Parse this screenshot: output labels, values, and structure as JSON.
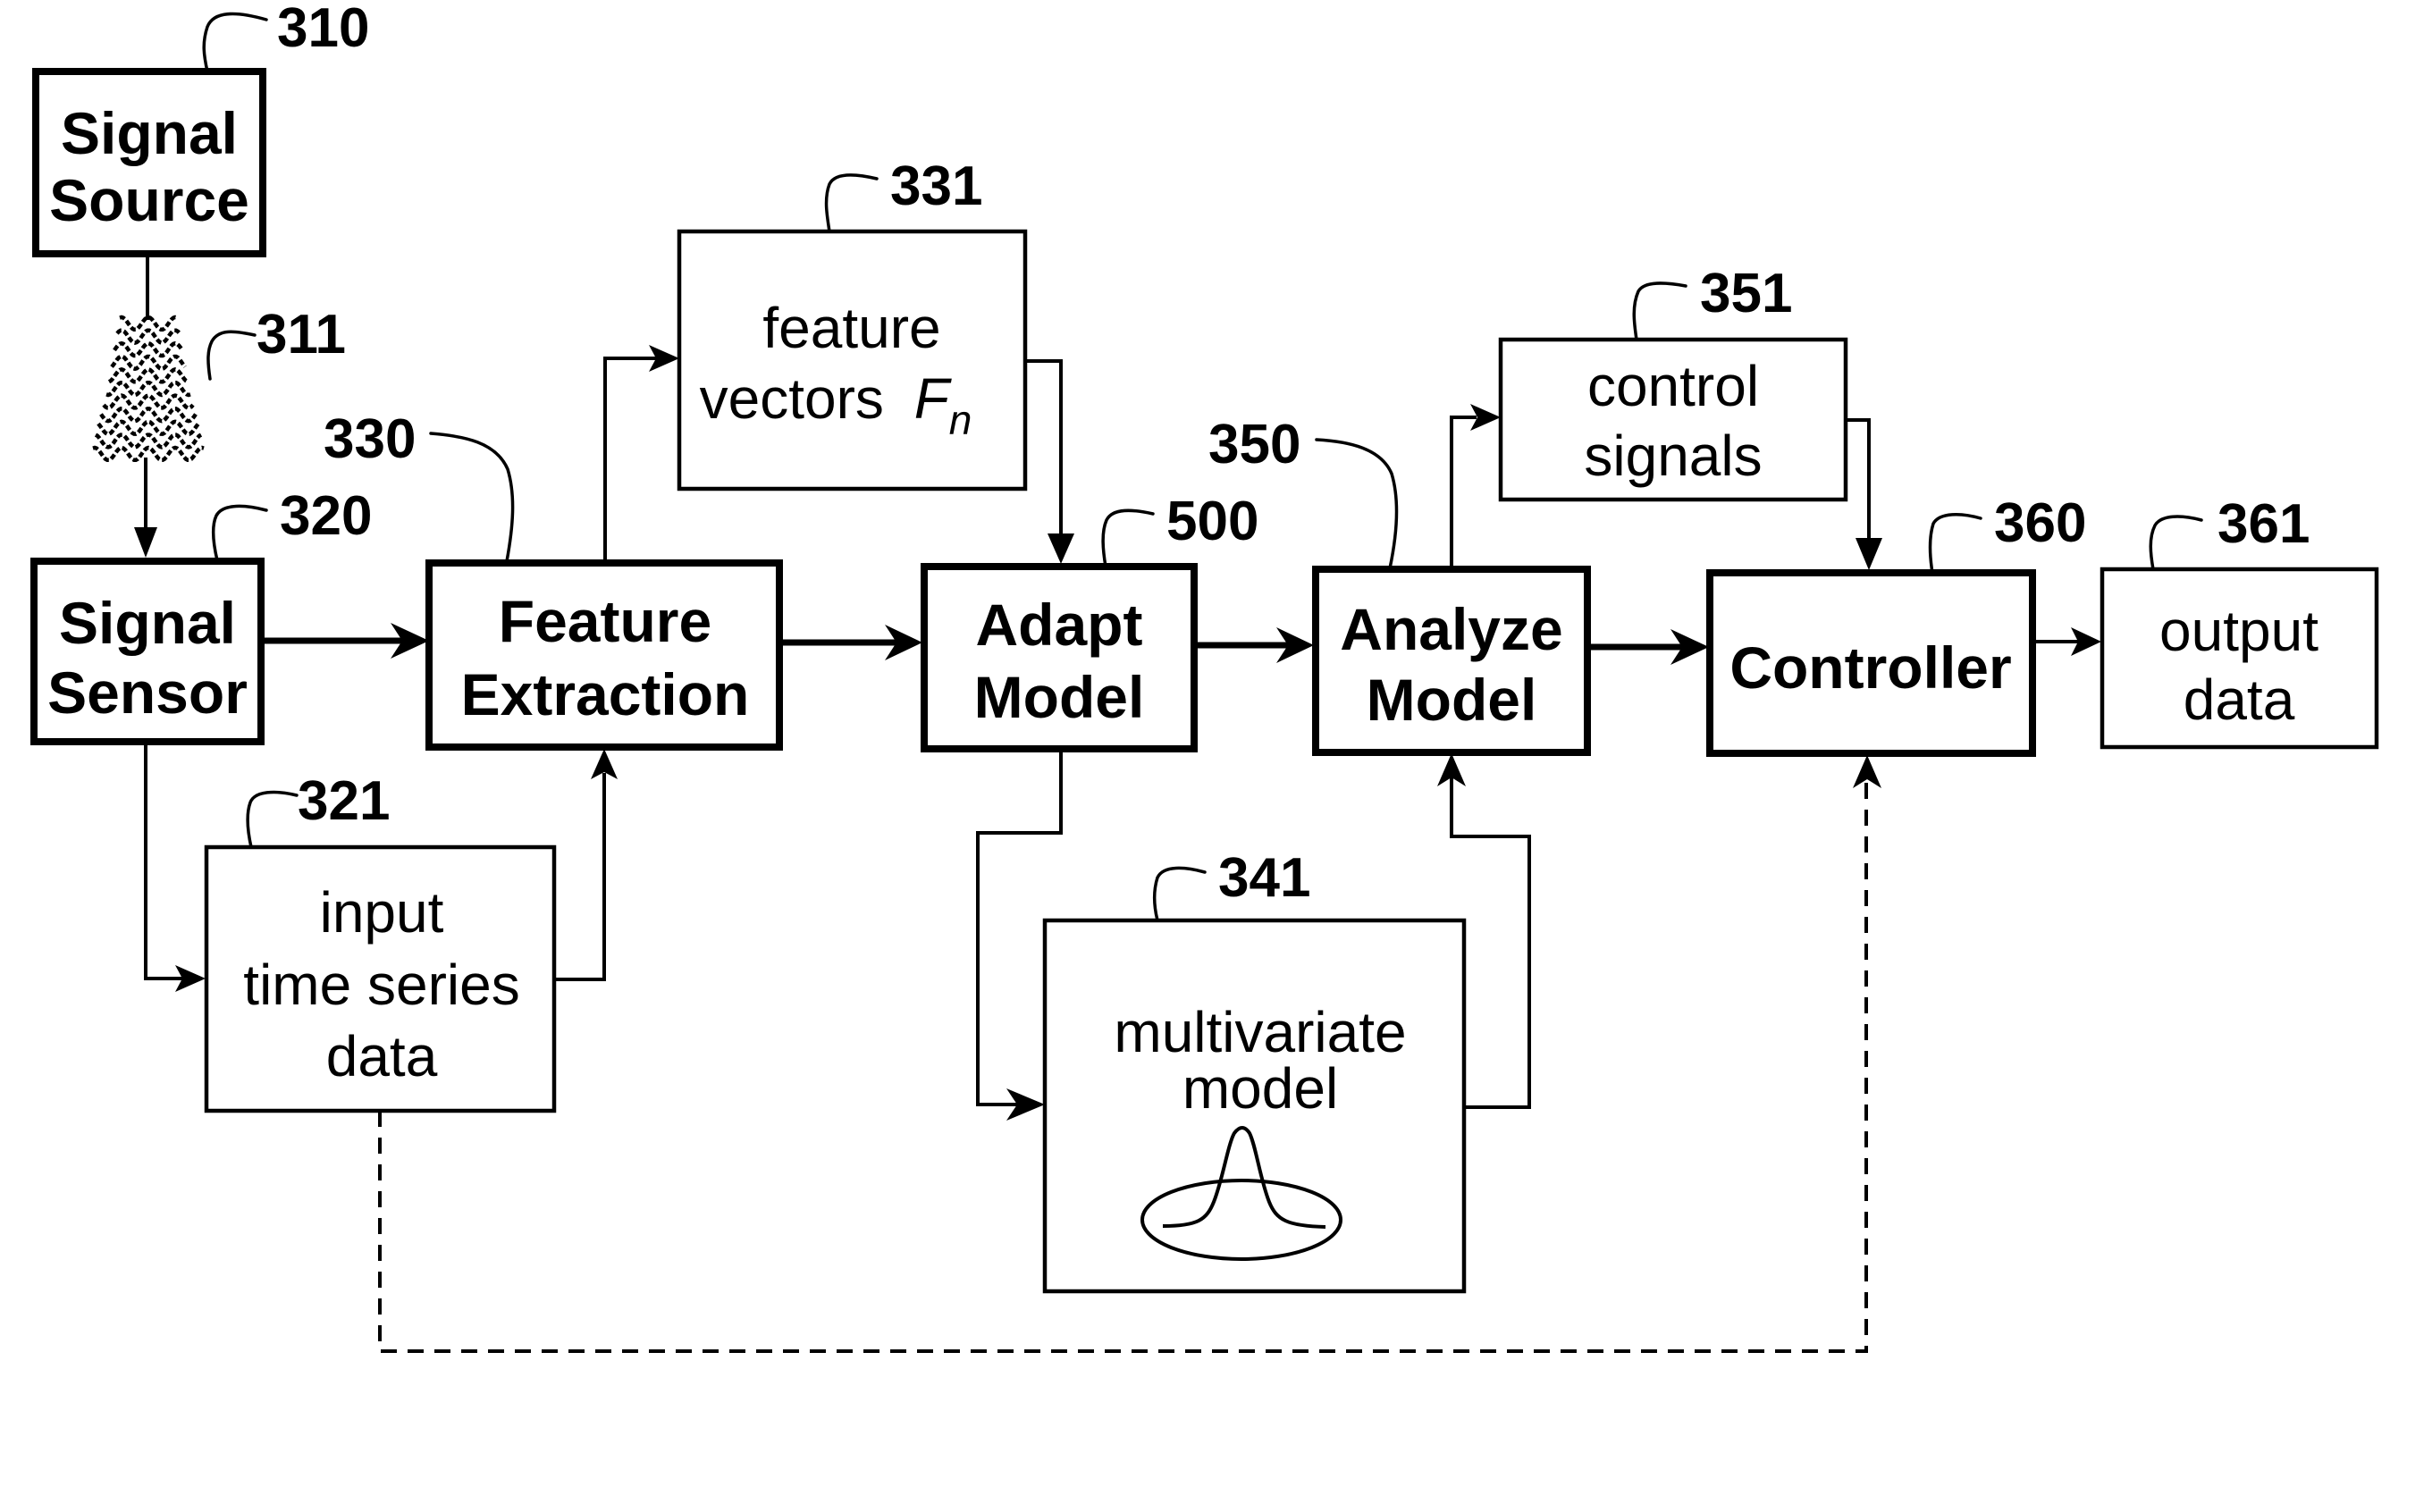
{
  "figure": {
    "type": "block-diagram",
    "description": "Signal processing flow from signal source through feature extraction and model adaptation to a controller"
  },
  "blocks": {
    "signal_source": {
      "ref": "310",
      "lines": [
        "Signal",
        "Source"
      ],
      "style": "bold"
    },
    "signal_sensor": {
      "ref": "320",
      "lines": [
        "Signal",
        "Sensor"
      ],
      "style": "bold"
    },
    "input_data": {
      "ref": "321",
      "lines": [
        "input",
        "time series",
        "data"
      ],
      "style": "regular"
    },
    "feature_extract": {
      "ref": "330",
      "lines": [
        "Feature",
        "Extraction"
      ],
      "style": "bold"
    },
    "feature_vectors": {
      "ref": "331",
      "lines": [
        "feature",
        "vectors"
      ],
      "symbol": "F",
      "subscript": "n",
      "style": "regular"
    },
    "adapt_model": {
      "ref": "500",
      "lines": [
        "Adapt",
        "Model"
      ],
      "style": "bold"
    },
    "mv_model": {
      "ref": "341",
      "lines": [
        "multivariate",
        "model"
      ],
      "style": "regular",
      "icon": "gaussian-distribution-icon"
    },
    "analyze_model": {
      "ref": "350",
      "lines": [
        "Analyze",
        "Model"
      ],
      "style": "bold"
    },
    "control_signals": {
      "ref": "351",
      "lines": [
        "control",
        "signals"
      ],
      "style": "regular"
    },
    "controller": {
      "ref": "360",
      "lines": [
        "Controller"
      ],
      "style": "bold"
    },
    "output_data": {
      "ref": "361",
      "lines": [
        "output",
        "data"
      ],
      "style": "regular"
    }
  },
  "signal_medium": {
    "ref": "311",
    "icon": "signal-wave-icon"
  },
  "connections": [
    {
      "from": "signal_source",
      "to": "signal_sensor",
      "via": "signal_medium",
      "style": "solid"
    },
    {
      "from": "signal_sensor",
      "to": "feature_extract",
      "style": "heavy"
    },
    {
      "from": "signal_sensor",
      "to": "input_data",
      "style": "solid"
    },
    {
      "from": "input_data",
      "to": "feature_extract",
      "style": "solid"
    },
    {
      "from": "feature_extract",
      "to": "feature_vectors",
      "style": "solid"
    },
    {
      "from": "feature_vectors",
      "to": "adapt_model",
      "style": "solid"
    },
    {
      "from": "feature_extract",
      "to": "adapt_model",
      "style": "heavy"
    },
    {
      "from": "adapt_model",
      "to": "mv_model",
      "style": "solid"
    },
    {
      "from": "mv_model",
      "to": "analyze_model",
      "style": "solid"
    },
    {
      "from": "adapt_model",
      "to": "analyze_model",
      "style": "heavy"
    },
    {
      "from": "analyze_model",
      "to": "control_signals",
      "style": "solid"
    },
    {
      "from": "control_signals",
      "to": "controller",
      "style": "solid"
    },
    {
      "from": "analyze_model",
      "to": "controller",
      "style": "heavy"
    },
    {
      "from": "controller",
      "to": "output_data",
      "style": "solid"
    },
    {
      "from": "input_data",
      "to": "controller",
      "style": "dashed"
    }
  ],
  "colors": {
    "ink": "#000000",
    "paper": "#ffffff"
  }
}
